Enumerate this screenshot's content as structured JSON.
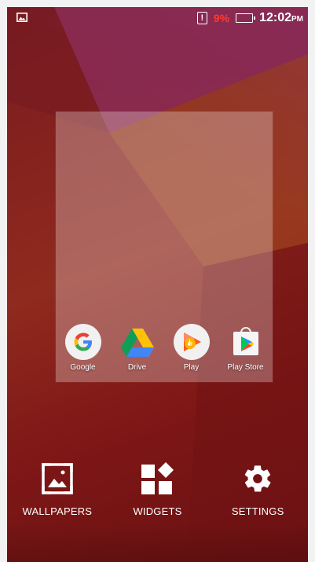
{
  "status_bar": {
    "left_icon": "image-notification-icon",
    "alert_icon": "alert-box-icon",
    "alert_text": "!",
    "battery_percent": "9%",
    "battery_icon": "battery-low-icon",
    "battery_level": 0.09,
    "time": "12:02",
    "ampm": "PM"
  },
  "preview": {
    "apps": [
      {
        "label": "Google",
        "icon": "google-icon"
      },
      {
        "label": "Drive",
        "icon": "drive-icon"
      },
      {
        "label": "Play",
        "icon": "play-music-icon"
      },
      {
        "label": "Play Store",
        "icon": "play-store-icon"
      }
    ]
  },
  "options": [
    {
      "label": "WALLPAPERS",
      "icon": "wallpapers-icon"
    },
    {
      "label": "WIDGETS",
      "icon": "widgets-icon"
    },
    {
      "label": "SETTINGS",
      "icon": "settings-gear-icon"
    }
  ],
  "colors": {
    "wallpaper_base": "#7e1716",
    "battery_warning": "#ff3b30"
  }
}
